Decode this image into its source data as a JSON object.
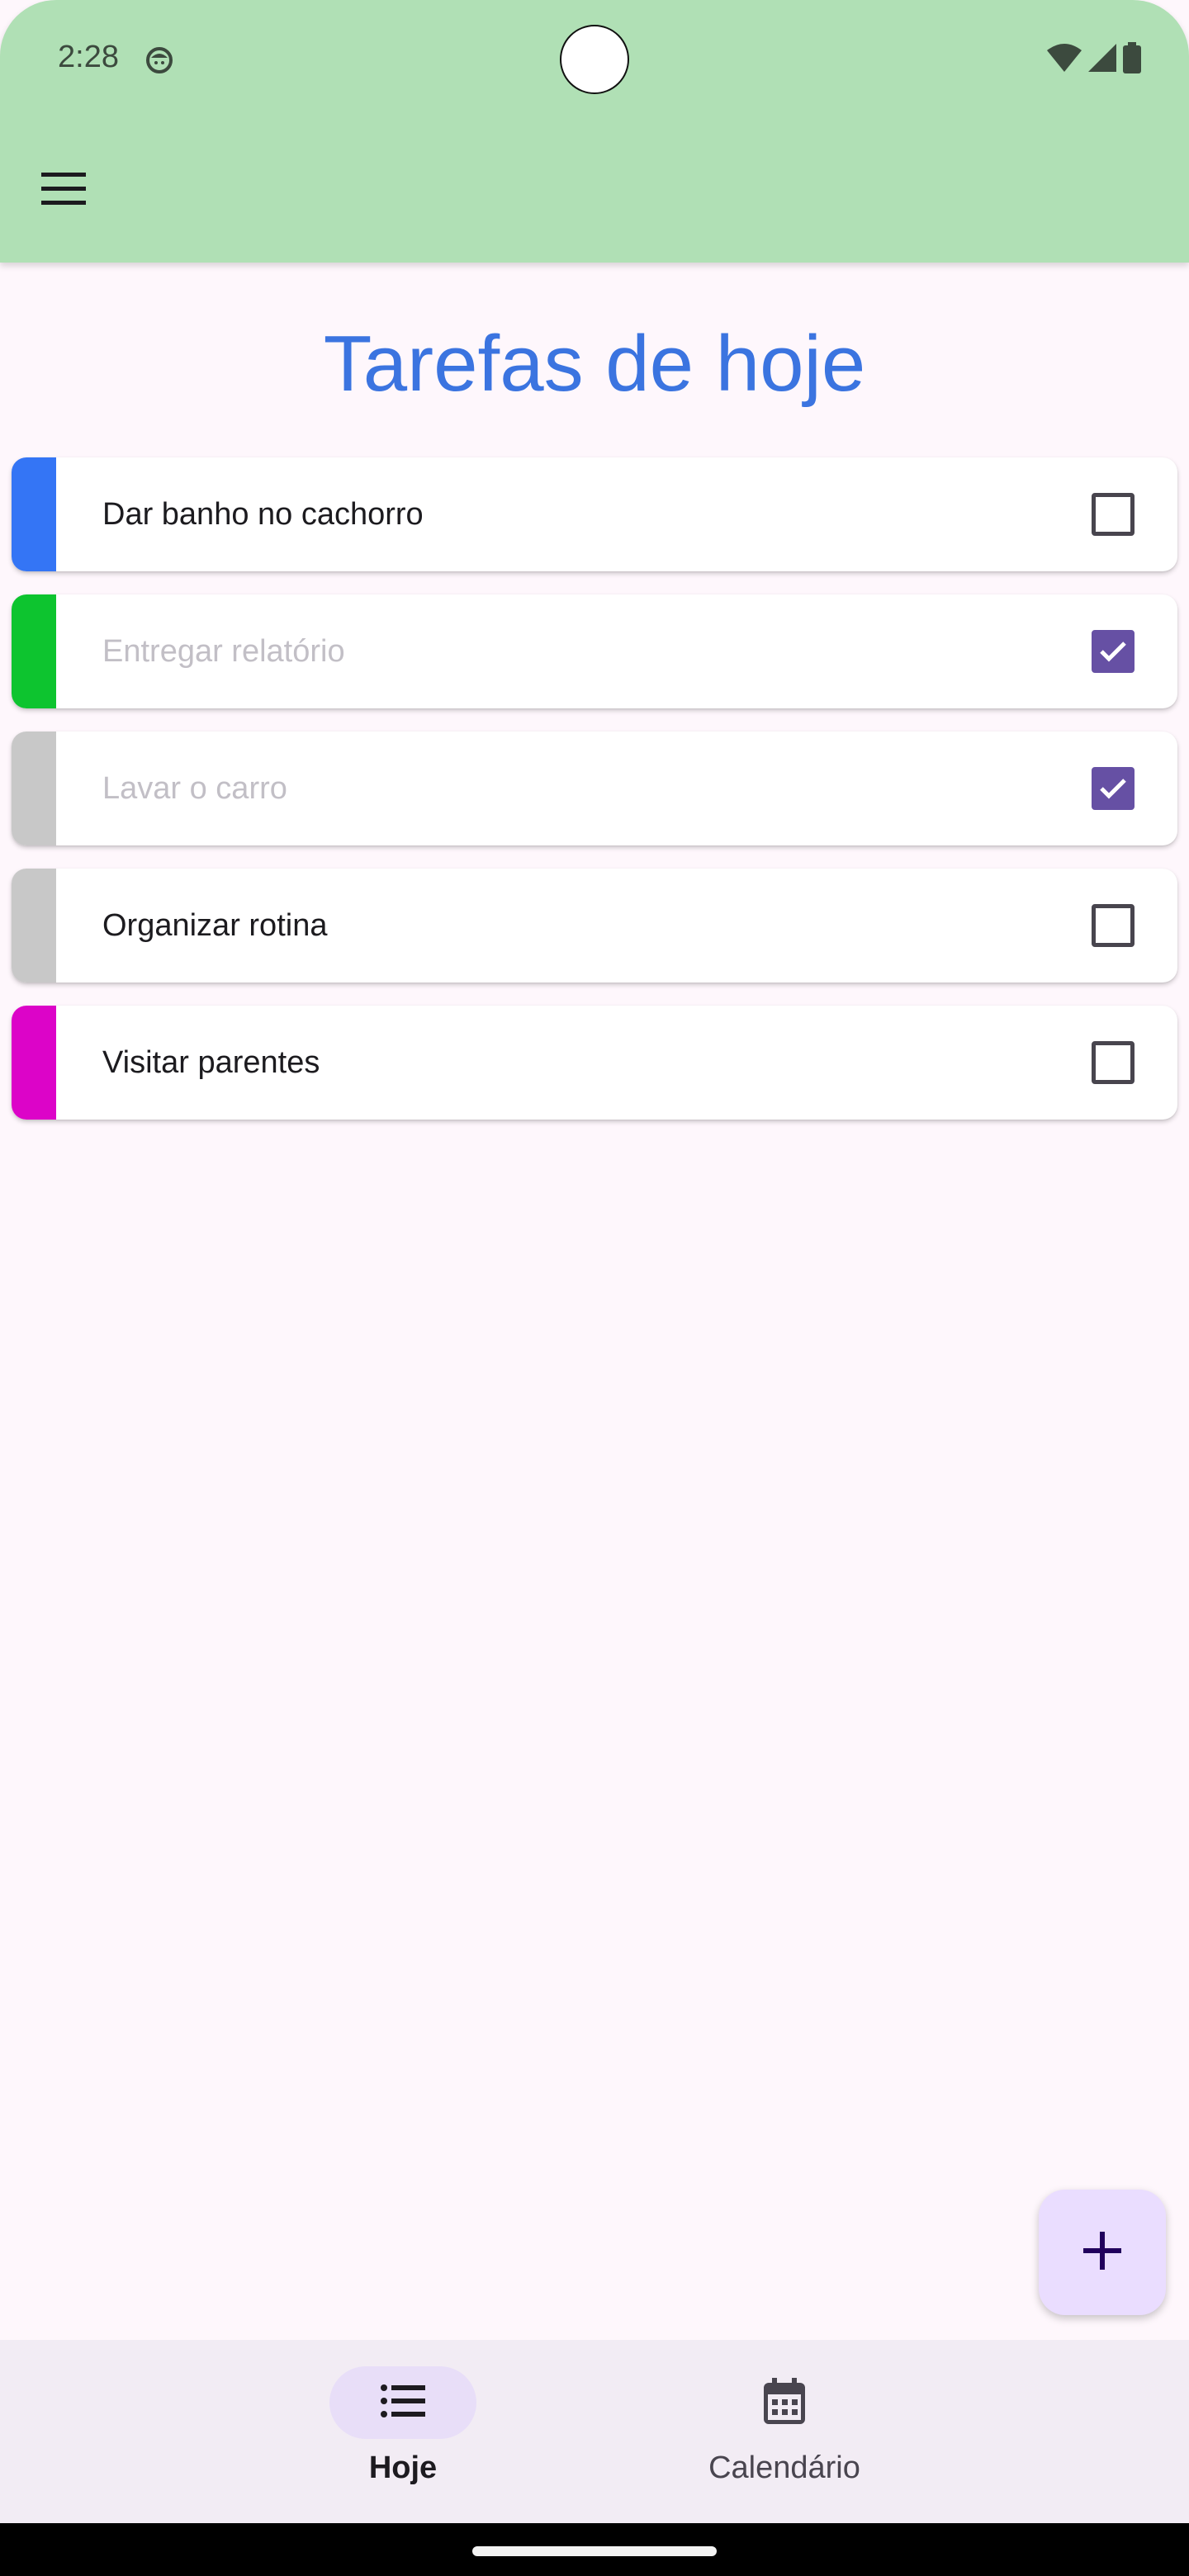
{
  "status_bar": {
    "time": "2:28",
    "icons": [
      "face-notification-icon",
      "wifi-icon",
      "cellular-signal-icon",
      "battery-icon"
    ]
  },
  "app_bar": {
    "menu_icon": "hamburger-menu-icon",
    "background": "#b0e0b5"
  },
  "page": {
    "title": "Tarefas de hoje",
    "title_color": "#3b74e0"
  },
  "tasks": [
    {
      "label": "Dar banho no cachorro",
      "color": "#3475f5",
      "checked": false
    },
    {
      "label": "Entregar relatório",
      "color": "#0dc42f",
      "checked": true
    },
    {
      "label": "Lavar o carro",
      "color": "#c8c8c8",
      "checked": true
    },
    {
      "label": "Organizar rotina",
      "color": "#c8c8c8",
      "checked": false
    },
    {
      "label": "Visitar parentes",
      "color": "#dc04c8",
      "checked": false
    }
  ],
  "fab": {
    "icon": "plus-icon"
  },
  "bottom_nav": {
    "items": [
      {
        "label": "Hoje",
        "icon": "list-icon",
        "active": true
      },
      {
        "label": "Calendário",
        "icon": "calendar-icon",
        "active": false
      }
    ]
  }
}
